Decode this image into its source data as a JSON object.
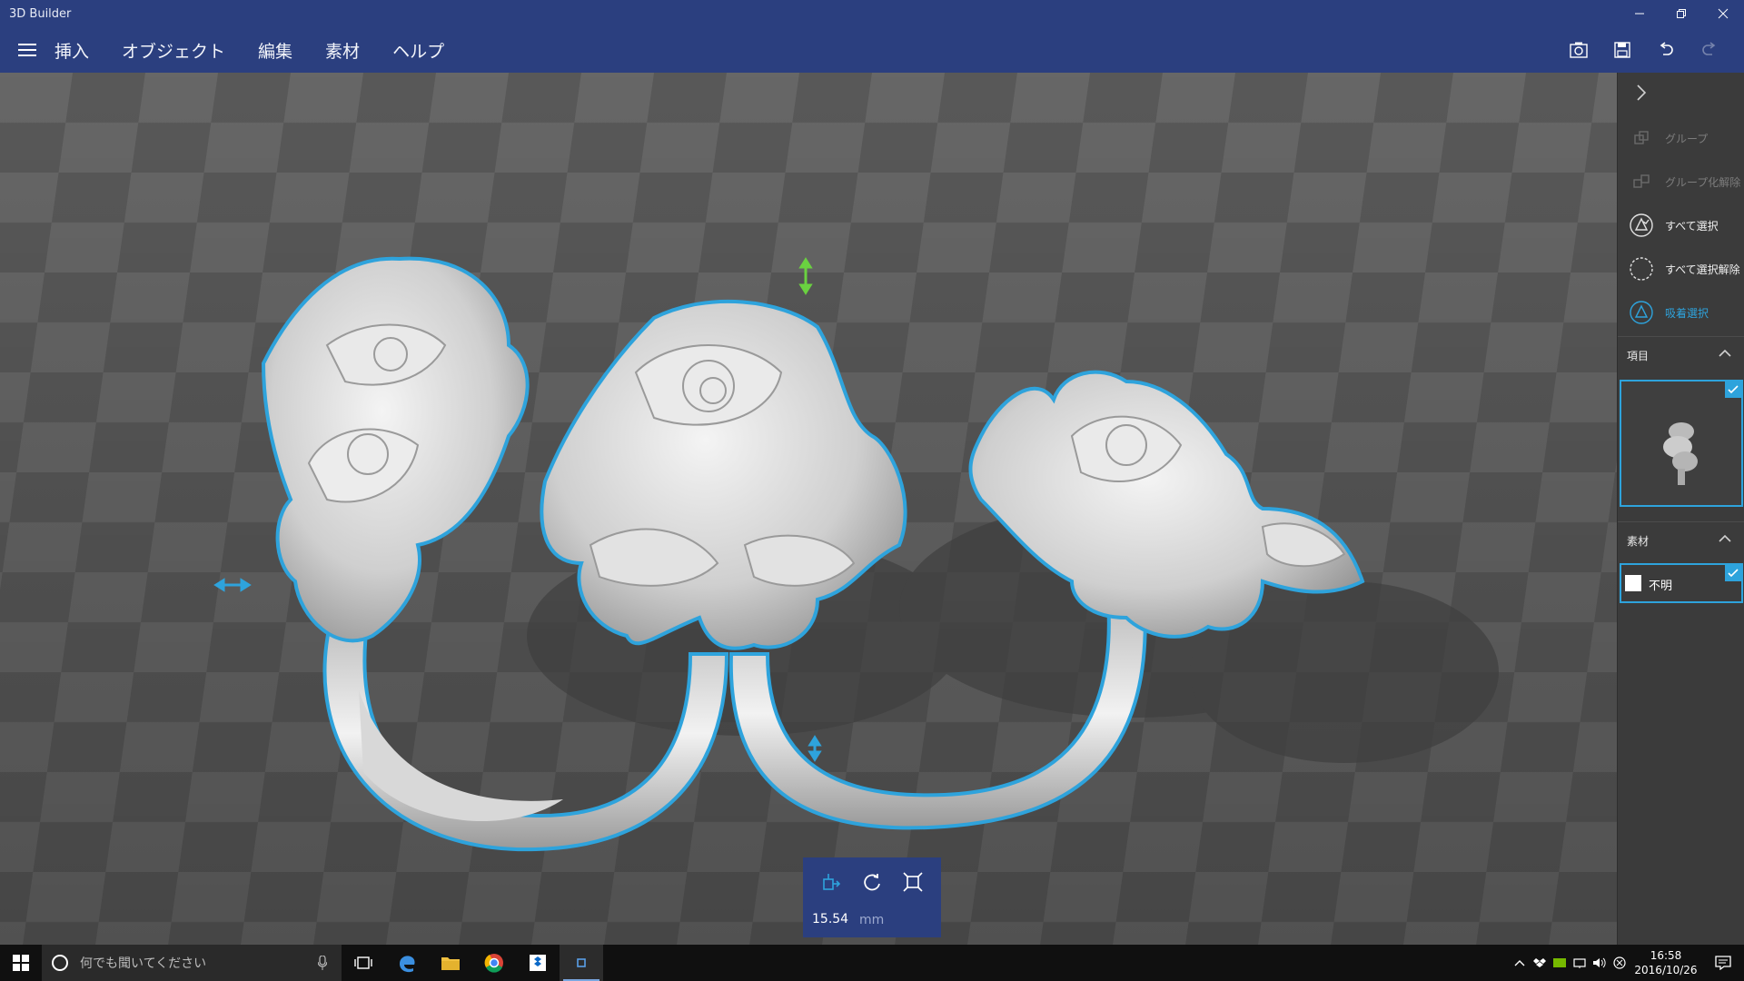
{
  "window": {
    "title": "3D Builder"
  },
  "menu": {
    "items": [
      {
        "label": "挿入"
      },
      {
        "label": "オブジェクト"
      },
      {
        "label": "編集"
      },
      {
        "label": "素材"
      },
      {
        "label": "ヘルプ"
      }
    ]
  },
  "panel": {
    "group": "グループ",
    "ungroup": "グループ化解除",
    "select_all": "すべて選択",
    "deselect_all": "すべて選択解除",
    "lasso_select": "吸着選択",
    "items_header": "項目",
    "material_header": "素材",
    "material_value": "不明"
  },
  "scale": {
    "value": "15.54",
    "unit": "mm"
  },
  "taskbar": {
    "search_placeholder": "何でも聞いてください",
    "time": "16:58",
    "date": "2016/10/26"
  },
  "colors": {
    "titlebar": "#2b3f7f",
    "accent": "#2ea3dc",
    "viewport_light": "#6a6a6a",
    "viewport_dark": "#4b4b4b"
  },
  "icons": [
    "hamburger-icon",
    "screenshot-icon",
    "save-icon",
    "undo-icon",
    "redo-icon"
  ]
}
